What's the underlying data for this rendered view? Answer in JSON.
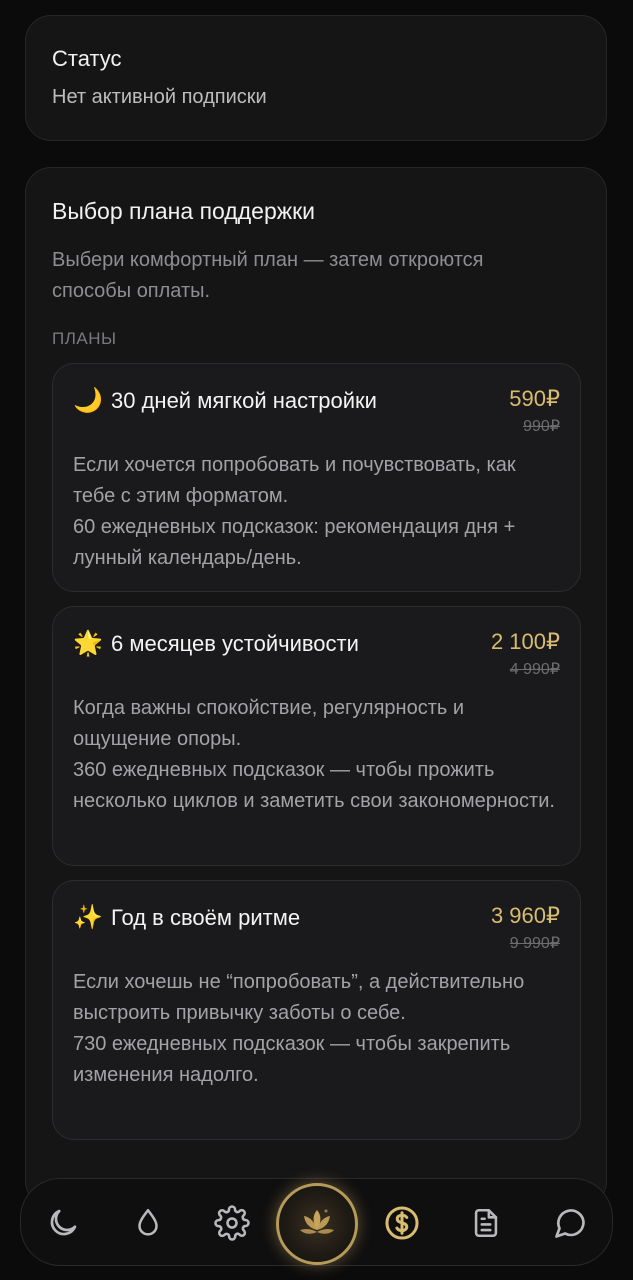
{
  "status": {
    "title": "Статус",
    "value": "Нет активной подписки"
  },
  "plans_section": {
    "title": "Выбор плана поддержки",
    "description": "Выбери комфортный план — затем откроются способы оплаты.",
    "label": "ПЛАНЫ",
    "plans": [
      {
        "icon": "crescent-moon-icon",
        "emoji": "🌙",
        "name": "30 дней мягкой настройки",
        "price": "590₽",
        "old_price": "990₽",
        "description_1": "Если хочется попробовать и почувствовать, как тебе с этим форматом.",
        "description_2": "60 ежедневных подсказок: рекомендация дня + лунный календарь/день."
      },
      {
        "icon": "glowing-star-icon",
        "emoji": "🌟",
        "name": "6 месяцев устойчивости",
        "price": "2 100₽",
        "old_price": "4 990₽",
        "description_1": "Когда важны спокойствие, регулярность и ощущение опоры.",
        "description_2": "360 ежедневных подсказок — чтобы прожить несколько циклов и заметить свои закономерности."
      },
      {
        "icon": "sparkles-icon",
        "emoji": "✨",
        "name": "Год в своём ритме",
        "price": "3 960₽",
        "old_price": "9 990₽",
        "description_1": "Если хочешь не “попробовать”, а действительно выстроить привычку заботы о себе.",
        "description_2": "730 ежедневных подсказок — чтобы закрепить изменения надолго."
      }
    ]
  },
  "nav": {
    "items": [
      "moon-icon",
      "drop-icon",
      "gear-icon",
      "lotus-icon",
      "dollar-coin-icon",
      "document-icon",
      "chat-icon"
    ],
    "active": "dollar-coin-icon",
    "accent": "#d8bc6f"
  },
  "colors": {
    "background": "#0b0b0c",
    "card": "#151516",
    "accent_gold": "#d8bc6f"
  }
}
